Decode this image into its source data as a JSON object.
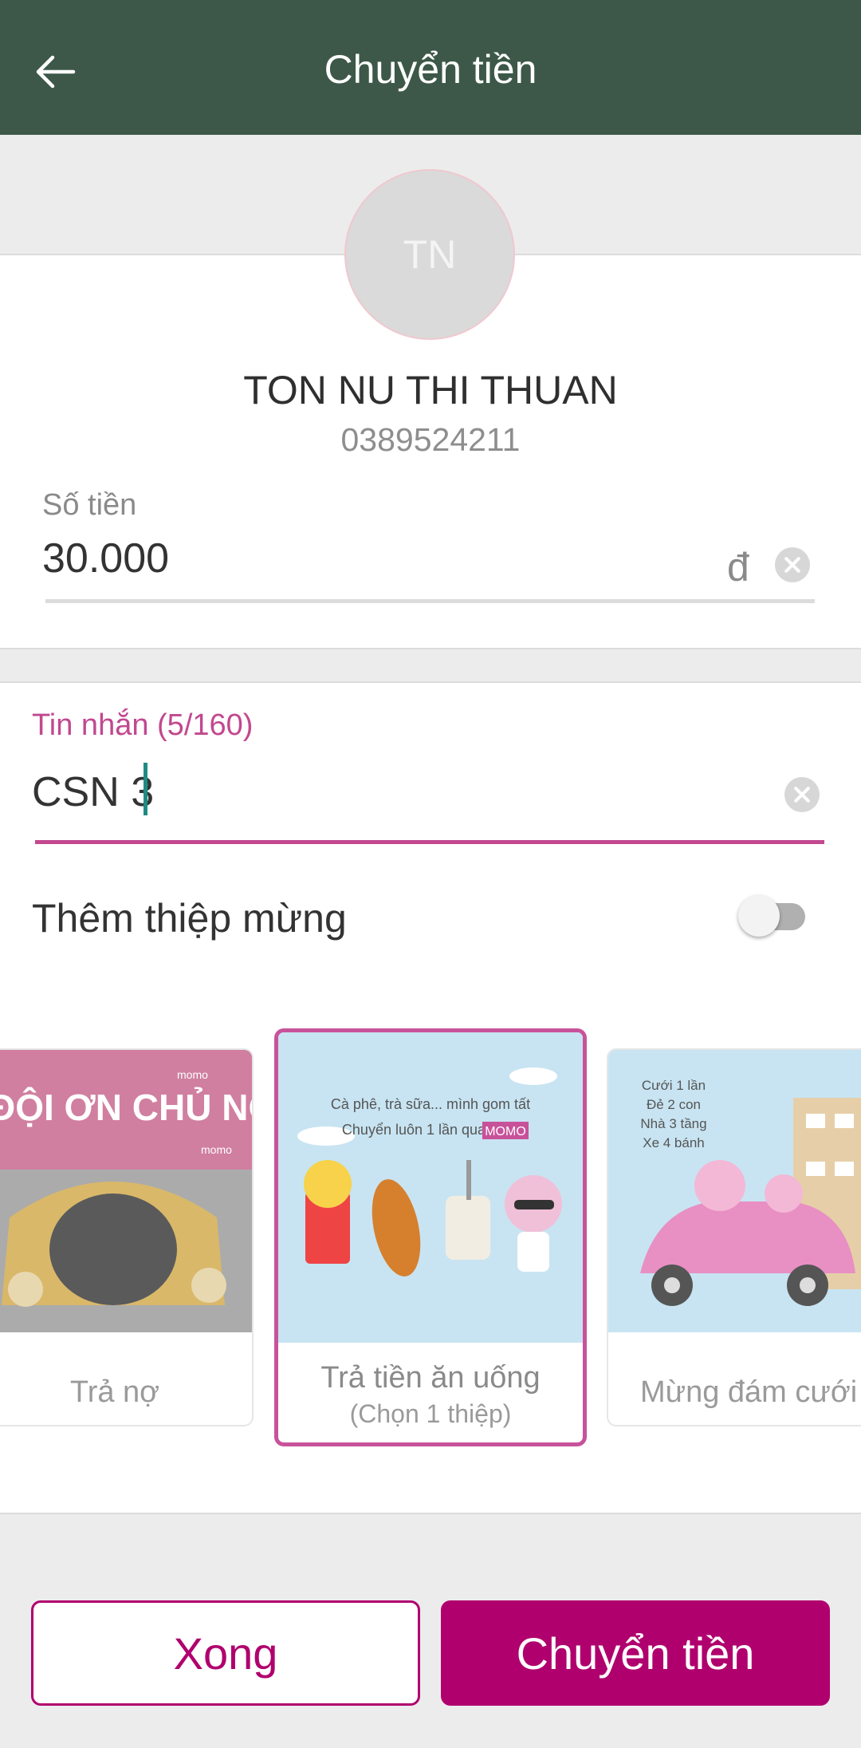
{
  "header": {
    "title": "Chuyển tiền",
    "back_icon": "arrow-left-icon"
  },
  "recipient": {
    "initials": "TN",
    "name": "TON NU THI THUAN",
    "phone": "0389524211"
  },
  "amount": {
    "label": "Số tiền",
    "value": "30.000",
    "currency": "đ"
  },
  "message": {
    "label": "Tin nhắn (5/160)",
    "value": "CSN 3"
  },
  "card_toggle": {
    "label": "Thêm thiệp mừng",
    "enabled": false
  },
  "cards": [
    {
      "caption": "Trả nợ",
      "art_text": "ĐỘI ƠN CHỦ NỢ",
      "brand": "momo"
    },
    {
      "caption": "Trả tiền ăn uống",
      "sub": "(Chọn 1 thiệp)",
      "art_line1": "Cà phê, trà sữa... mình gom tất",
      "art_line2": "Chuyển luôn 1 lần qua",
      "brand": "MOMO"
    },
    {
      "caption": "Mừng đám cưới",
      "art_lines": [
        "Cưới 1 lần",
        "Đẻ 2 con",
        "Nhà 3 tầng",
        "Xe 4 bánh"
      ]
    }
  ],
  "actions": {
    "done": "Xong",
    "send": "Chuyển tiền"
  },
  "colors": {
    "header": "#3d5848",
    "accent": "#b0006e",
    "message_accent": "#c2488f"
  }
}
